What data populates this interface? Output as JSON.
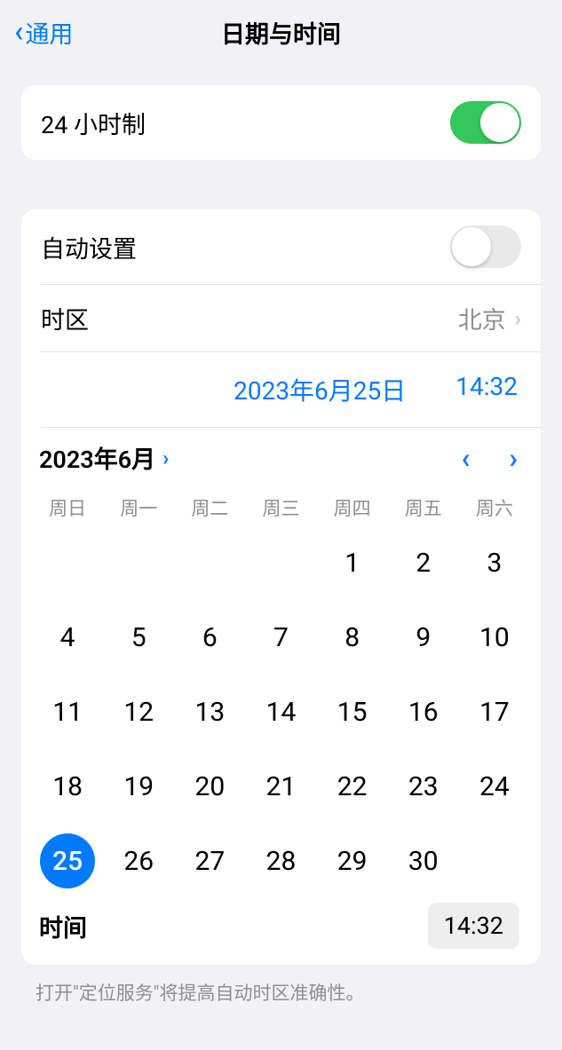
{
  "header": {
    "back_label": "通用",
    "title": "日期与时间"
  },
  "settings": {
    "hour24_label": "24 小时制",
    "auto_set_label": "自动设置",
    "timezone_label": "时区",
    "timezone_value": "北京"
  },
  "picker": {
    "date_display": "2023年6月25日",
    "time_display": "14:32",
    "month_label": "2023年6月",
    "weekdays": [
      "周日",
      "周一",
      "周二",
      "周三",
      "周四",
      "周五",
      "周六"
    ],
    "leading_blanks": 4,
    "days": [
      1,
      2,
      3,
      4,
      5,
      6,
      7,
      8,
      9,
      10,
      11,
      12,
      13,
      14,
      15,
      16,
      17,
      18,
      19,
      20,
      21,
      22,
      23,
      24,
      25,
      26,
      27,
      28,
      29,
      30
    ],
    "selected_day": 25,
    "time_label": "时间",
    "time_value": "14:32"
  },
  "footer_note": "打开\"定位服务\"将提高自动时区准确性。"
}
